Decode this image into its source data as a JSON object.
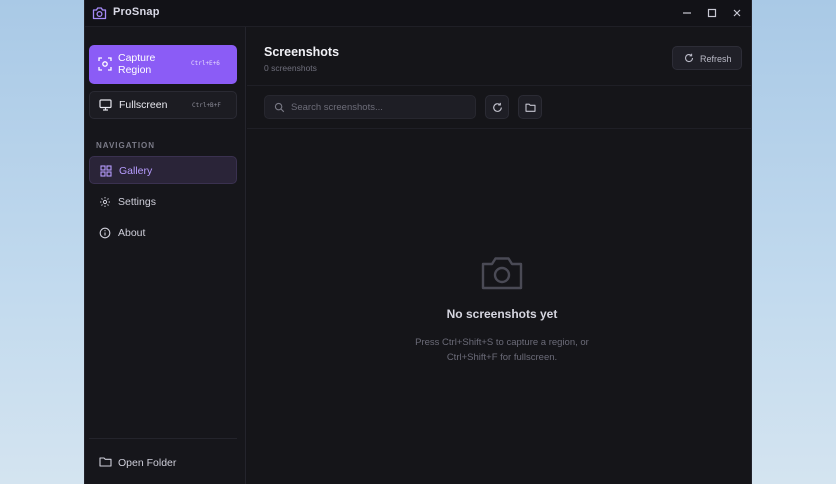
{
  "app": {
    "title": "ProSnap",
    "window_controls": [
      "minimize-icon",
      "maximize-icon",
      "close-icon"
    ]
  },
  "sidebar": {
    "capture_region": {
      "label": "Capture Region",
      "shortcut": "Ctrl+E+6",
      "icon": "capture-region-icon"
    },
    "fullscreen": {
      "label": "Fullscreen",
      "shortcut": "Ctrl+B+F",
      "icon": "monitor-icon"
    },
    "nav_heading": "NAVIGATION",
    "nav_items": [
      {
        "label": "Gallery",
        "icon": "grid-icon",
        "active": true
      },
      {
        "label": "Settings",
        "icon": "gear-icon",
        "active": false
      },
      {
        "label": "About",
        "icon": "info-icon",
        "active": false
      }
    ],
    "open_folder": {
      "label": "Open Folder",
      "icon": "folder-icon"
    }
  },
  "main": {
    "title": "Screenshots",
    "subtitle": "0 screenshots",
    "refresh_label": "Refresh",
    "search": {
      "placeholder": "Search screenshots...",
      "value": ""
    },
    "empty": {
      "title": "No screenshots yet",
      "line1": "Press Ctrl+Shift+S to capture a region, or",
      "line2": "Ctrl+Shift+F for fullscreen."
    }
  },
  "colors": {
    "accent": "#8b5cf6",
    "active_nav_text": "#b79cff",
    "window_bg": "#141419",
    "sidebar_bg": "#16161b"
  }
}
